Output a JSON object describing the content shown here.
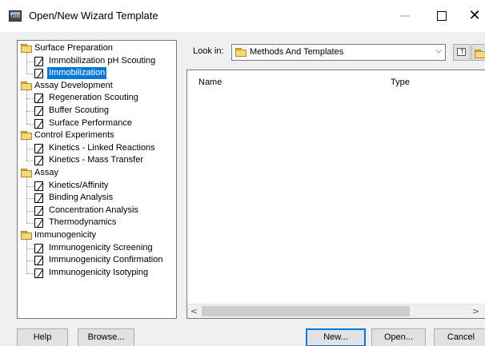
{
  "window": {
    "title": "Open/New Wizard Template",
    "icon_text": "T200",
    "minimize_glyph": "—",
    "close_glyph": "✕"
  },
  "tree": {
    "groups": [
      {
        "label": "Surface Preparation",
        "items": [
          {
            "label": "Immobilization pH Scouting",
            "selected": false
          },
          {
            "label": "Immobilization",
            "selected": true
          }
        ]
      },
      {
        "label": "Assay Development",
        "items": [
          {
            "label": "Regeneration Scouting",
            "selected": false
          },
          {
            "label": "Buffer Scouting",
            "selected": false
          },
          {
            "label": "Surface Performance",
            "selected": false
          }
        ]
      },
      {
        "label": "Control Experiments",
        "items": [
          {
            "label": "Kinetics - Linked Reactions",
            "selected": false
          },
          {
            "label": "Kinetics - Mass Transfer",
            "selected": false
          }
        ]
      },
      {
        "label": "Assay",
        "items": [
          {
            "label": "Kinetics/Affinity",
            "selected": false
          },
          {
            "label": "Binding Analysis",
            "selected": false
          },
          {
            "label": "Concentration Analysis",
            "selected": false
          },
          {
            "label": "Thermodynamics",
            "selected": false
          }
        ]
      },
      {
        "label": "Immunogenicity",
        "items": [
          {
            "label": "Immunogenicity Screening",
            "selected": false
          },
          {
            "label": "Immunogenicity Confirmation",
            "selected": false
          },
          {
            "label": "Immunogenicity Isotyping",
            "selected": false
          }
        ]
      }
    ]
  },
  "lookin": {
    "label": "Look in:",
    "value": "Methods And Templates",
    "chevron": "⌵"
  },
  "file_list": {
    "columns": [
      "Name",
      "Type"
    ],
    "scroll_left": "<",
    "scroll_right": ">"
  },
  "buttons": {
    "help": "Help",
    "browse": "Browse...",
    "new": "New...",
    "open": "Open...",
    "cancel": "Cancel"
  },
  "colors": {
    "selection": "#0078d7",
    "folder": "#f5d978"
  }
}
